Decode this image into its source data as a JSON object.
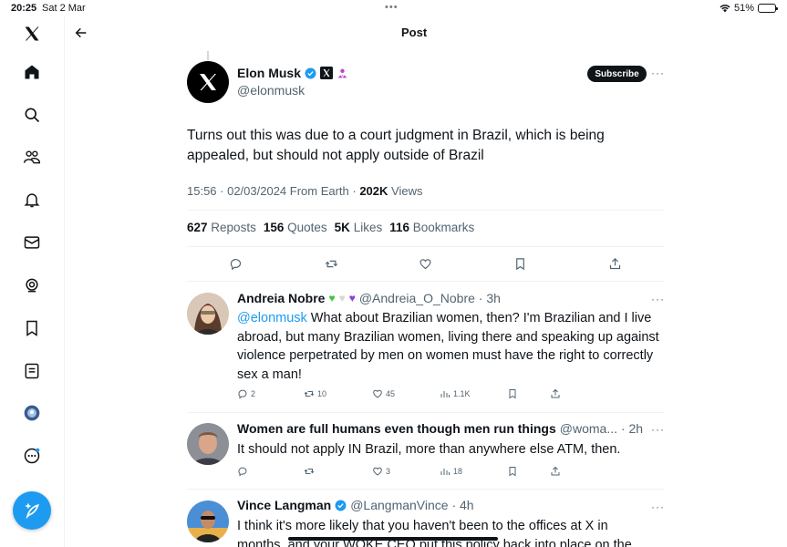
{
  "status_bar": {
    "time": "20:25",
    "date": "Sat 2 Mar",
    "battery": "51%",
    "battery_level": 0.51
  },
  "header": {
    "title": "Post"
  },
  "sidebar": {
    "items": [
      {
        "icon": "x-logo-icon"
      },
      {
        "icon": "home-icon"
      },
      {
        "icon": "search-icon"
      },
      {
        "icon": "communities-icon"
      },
      {
        "icon": "bell-icon"
      },
      {
        "icon": "mail-icon"
      },
      {
        "icon": "grok-icon"
      },
      {
        "icon": "bookmark-icon"
      },
      {
        "icon": "lists-icon"
      },
      {
        "icon": "profile-avatar"
      },
      {
        "icon": "more-icon"
      }
    ],
    "compose_icon": "compose-icon"
  },
  "post": {
    "author_name": "Elon Musk",
    "handle": "@elonmusk",
    "subscribe_label": "Subscribe",
    "text": "Turns out this was due to a court judgment in Brazil, which is being appealed, but should not apply outside of Brazil",
    "timestamp": "15:56 · 02/03/2024 From Earth · ",
    "views_count": "202K",
    "views_label": " Views",
    "stats": {
      "reposts_count": "627",
      "reposts_label": "Reposts",
      "quotes_count": "156",
      "quotes_label": "Quotes",
      "likes_count": "5K",
      "likes_label": "Likes",
      "bookmarks_count": "116",
      "bookmarks_label": "Bookmarks"
    }
  },
  "replies": [
    {
      "name": "Andreia Nobre",
      "handle_time": "@Andreia_O_Nobre · 3h",
      "mention": "@elonmusk",
      "text": " What about Brazilian women, then? I'm Brazilian and I live abroad, but many Brazilian women, living there and speaking up against violence perpetrated by men on women must have the right to correctly sex a man!",
      "replies": "2",
      "reposts": "10",
      "likes": "45",
      "views": "1.1K"
    },
    {
      "name": "Women are full humans even though men run things",
      "handle_time": "@woma... · 2h",
      "text": "It should not apply IN Brazil, more than anywhere else ATM, then.",
      "replies": "",
      "reposts": "",
      "likes": "3",
      "views": "18"
    },
    {
      "name": "Vince Langman",
      "handle_time": "@LangmanVince · 4h",
      "text_line1": "I think it's more likely that you haven't been to the offices at X in",
      "text_line2": "months, and your WOKE CEO put this policy back into place on the"
    }
  ]
}
